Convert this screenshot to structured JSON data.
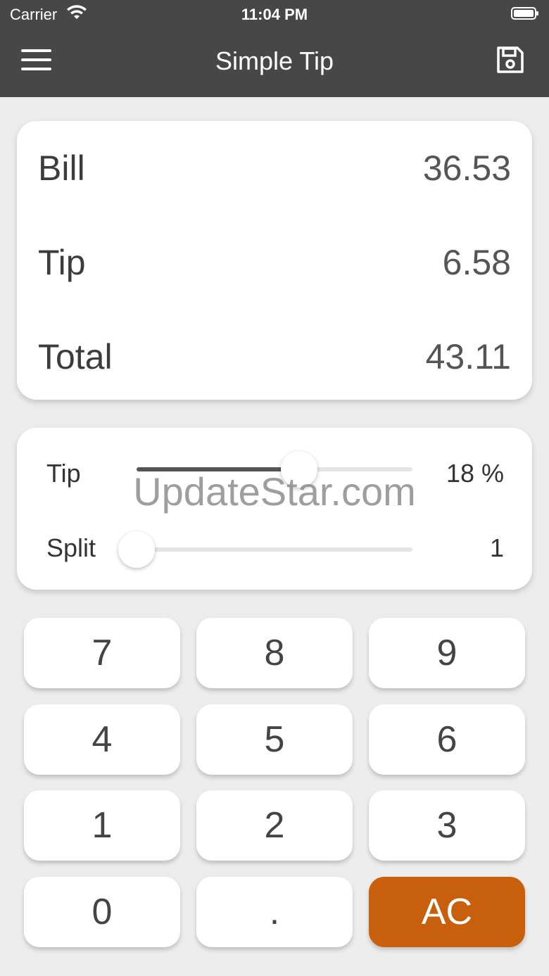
{
  "status_bar": {
    "carrier": "Carrier",
    "time": "11:04 PM"
  },
  "nav": {
    "title": "Simple Tip",
    "menu_icon": "hamburger-menu-icon",
    "save_icon": "floppy-disk-save-icon"
  },
  "summary": {
    "bill_label": "Bill",
    "bill_value": "36.53",
    "tip_label": "Tip",
    "tip_value": "6.58",
    "total_label": "Total",
    "total_value": "43.11"
  },
  "controls": {
    "tip_label": "Tip",
    "tip_value": "18 %",
    "tip_fraction": 0.59,
    "split_label": "Split",
    "split_value": "1",
    "split_fraction": 0.0
  },
  "watermark": "UpdateStar.com",
  "keypad": [
    "7",
    "8",
    "9",
    "4",
    "5",
    "6",
    "1",
    "2",
    "3",
    "0",
    ".",
    "AC"
  ],
  "colors": {
    "header": "#474747",
    "accent": "#c85f0c",
    "background": "#ececec"
  }
}
